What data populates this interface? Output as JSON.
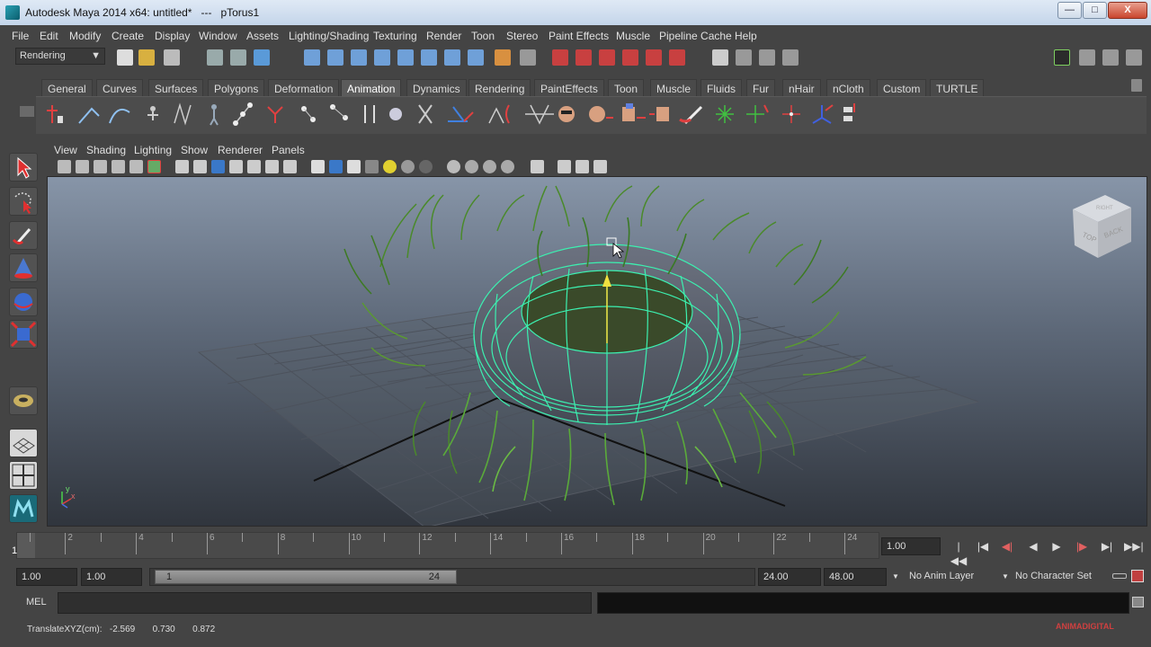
{
  "window": {
    "title": "Autodesk Maya 2014 x64: untitled*   ---   pTorus1",
    "minimize": "—",
    "maximize": "□",
    "close": "X"
  },
  "menubar": [
    "File",
    "Edit",
    "Modify",
    "Create",
    "Display",
    "Window",
    "Assets",
    "Lighting/Shading",
    "Texturing",
    "Render",
    "Toon",
    "Stereo",
    "Paint Effects",
    "Muscle",
    "Pipeline Cache",
    "Help"
  ],
  "statusline": {
    "mode": "Rendering"
  },
  "shelf": {
    "tabs": [
      "General",
      "Curves",
      "Surfaces",
      "Polygons",
      "Deformation",
      "Animation",
      "Dynamics",
      "Rendering",
      "PaintEffects",
      "Toon",
      "Muscle",
      "Fluids",
      "Fur",
      "nHair",
      "nCloth",
      "Custom",
      "TURTLE"
    ],
    "active_tab": "Animation"
  },
  "panel": {
    "menus": [
      "View",
      "Shading",
      "Lighting",
      "Show",
      "Renderer",
      "Panels"
    ],
    "viewcube_top": "TOP",
    "viewcube_back": "BACK",
    "viewcube_side": "RIGHT",
    "axis_y": "y",
    "axis_x": "x"
  },
  "timeslider": {
    "ticks": [
      "2",
      "4",
      "6",
      "8",
      "10",
      "12",
      "14",
      "16",
      "18",
      "20",
      "22",
      "24"
    ],
    "current_frame": "1",
    "current_time_field": "1.00",
    "playback_buttons": [
      "|◀◀",
      "|◀",
      "◀|",
      "◀",
      "▶",
      "|▶",
      "▶|",
      "▶▶|"
    ]
  },
  "rangeslider": {
    "start_time": "1.00",
    "playback_start": "1.00",
    "range_start_label": "1",
    "range_end_label": "24",
    "playback_end": "24.00",
    "end_time": "48.00",
    "anim_layer": "No Anim Layer",
    "character_set": "No Character Set"
  },
  "commandline": {
    "label": "MEL"
  },
  "helpline": {
    "text": "TranslateXYZ(cm):   -2.569       0.730       0.872"
  },
  "watermark": "ANIMADIGITAL",
  "colors": {
    "selection_wire": "#3cf0b0",
    "grass": "#4a8a2a",
    "accent": "#e0332a"
  }
}
